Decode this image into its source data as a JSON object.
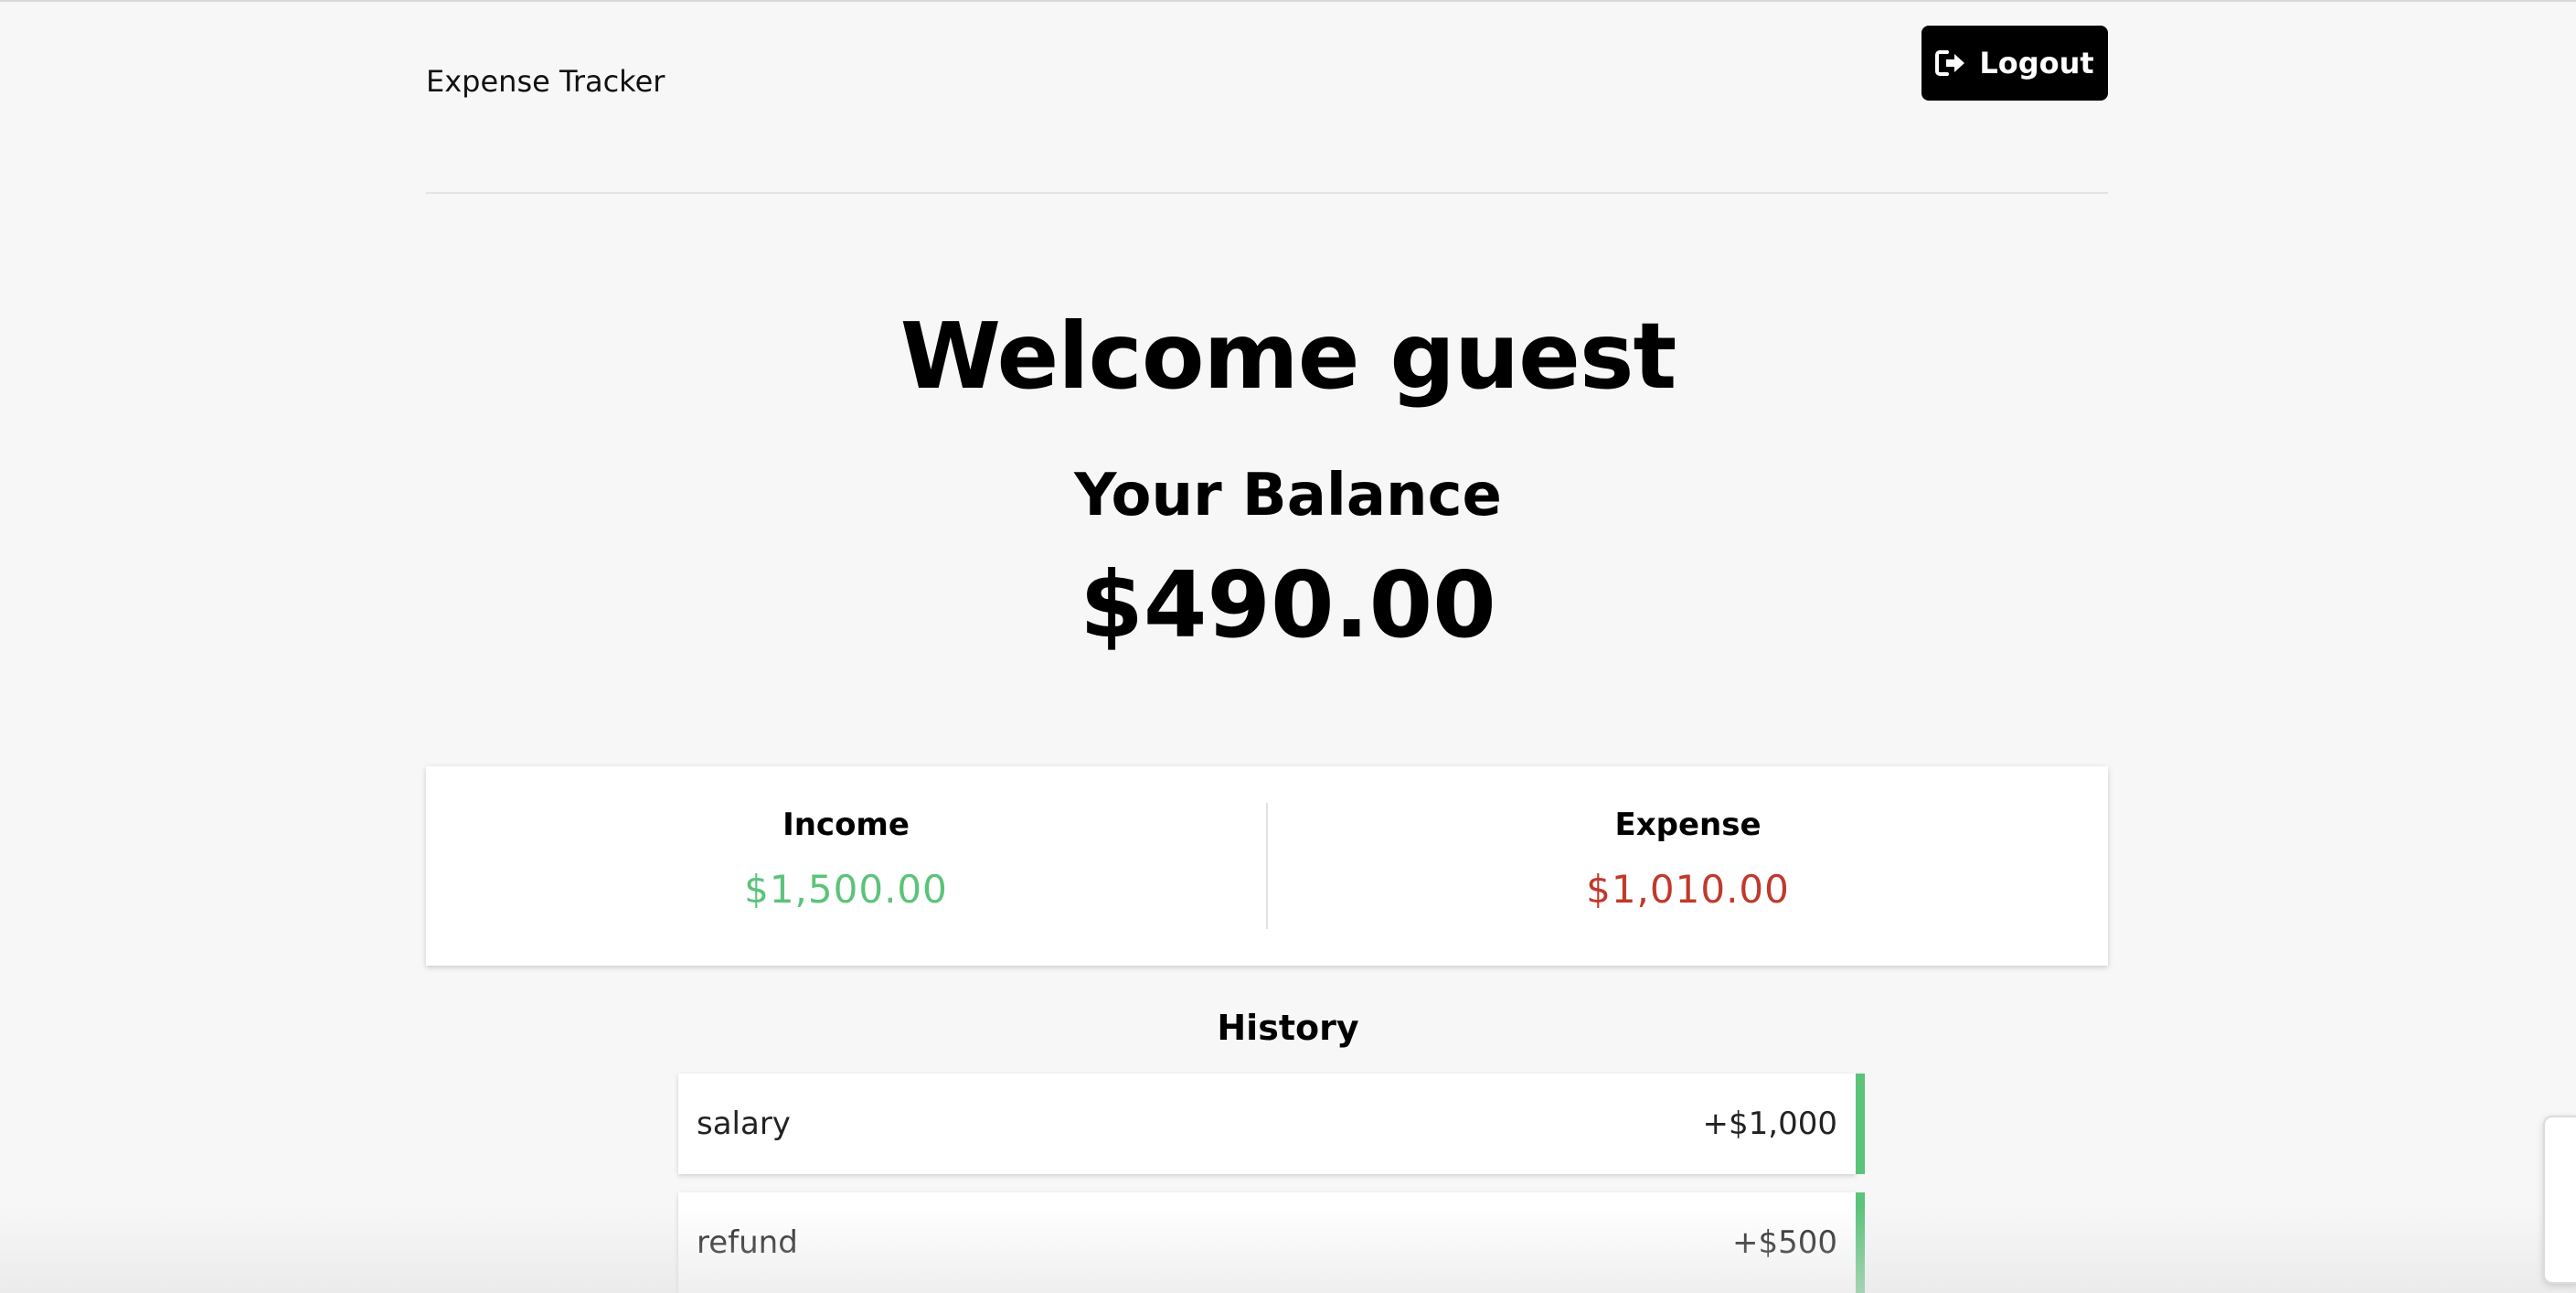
{
  "header": {
    "app_title": "Expense Tracker",
    "logout_label": "Logout"
  },
  "main": {
    "welcome": "Welcome guest",
    "balance_label": "Your Balance",
    "balance_value": "$490.00"
  },
  "summary": {
    "income_label": "Income",
    "income_value": "$1,500.00",
    "expense_label": "Expense",
    "expense_value": "$1,010.00"
  },
  "history": {
    "title": "History",
    "items": [
      {
        "name": "salary",
        "amount": "+$1,000",
        "type": "income"
      },
      {
        "name": "refund",
        "amount": "+$500",
        "type": "income"
      }
    ]
  },
  "colors": {
    "income": "#5cc37a",
    "expense": "#c0392b",
    "background": "#f7f7f7",
    "button": "#000000"
  },
  "icons": {
    "logout": "sign-out-icon"
  }
}
